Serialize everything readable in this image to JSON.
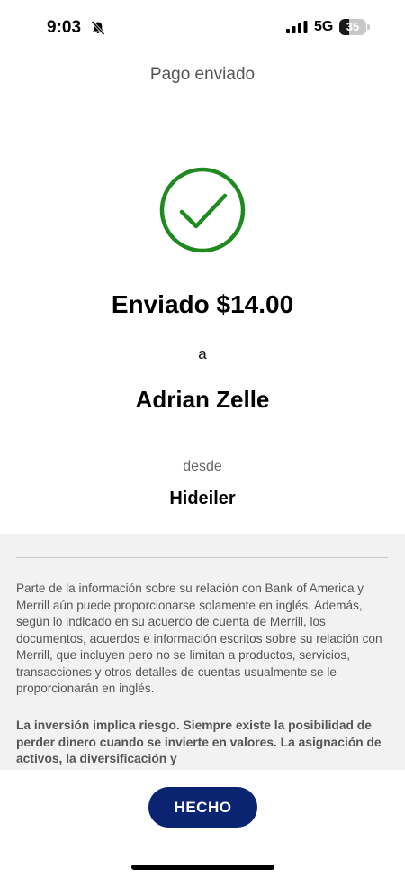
{
  "status_bar": {
    "time": "9:03",
    "network": "5G",
    "battery_percent": "35",
    "battery_level": 0.35,
    "icons": [
      "bell-slash-icon",
      "signal-icon",
      "battery-icon"
    ]
  },
  "header": {
    "title": "Pago enviado"
  },
  "confirmation": {
    "icon": "checkmark-circle-icon",
    "amount_text": "Enviado $14.00",
    "to_label": "a",
    "recipient": "Adrian Zelle",
    "from_label": "desde",
    "account": "Hideiler"
  },
  "disclosure": {
    "text": "Parte de la información sobre su relación con Bank of America y Merrill aún puede proporcionarse solamente en inglés. Además, según lo indicado en su acuerdo de cuenta de Merrill, los documentos, acuerdos e información escritos sobre su relación con Merrill, que incluyen pero no se limitan a productos, servicios, transacciones y otros detalles de cuentas usualmente se le proporcionarán en inglés.",
    "risk_text": "La inversión implica riesgo. Siempre existe la posibilidad de perder dinero cuando se invierte en valores. La asignación de activos, la diversificación y"
  },
  "footer": {
    "done_label": "HECHO"
  },
  "colors": {
    "check_green": "#1f8a1f",
    "button_navy": "#0a2472",
    "disclosure_bg": "#f2f2f2"
  }
}
